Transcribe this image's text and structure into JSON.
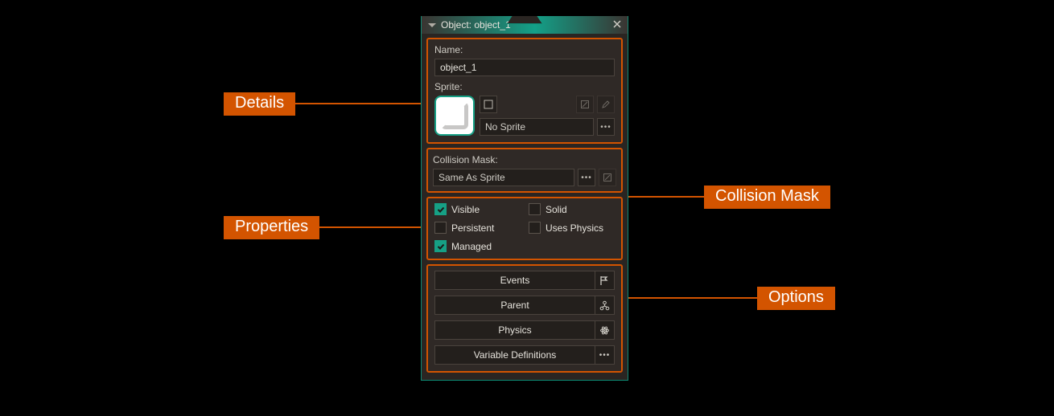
{
  "window": {
    "title": "Object: object_1"
  },
  "details": {
    "name_label": "Name:",
    "name_value": "object_1",
    "sprite_label": "Sprite:",
    "sprite_select": "No Sprite"
  },
  "collision": {
    "label": "Collision Mask:",
    "value": "Same As Sprite"
  },
  "props": {
    "visible": {
      "label": "Visible",
      "checked": true
    },
    "solid": {
      "label": "Solid",
      "checked": false
    },
    "persistent": {
      "label": "Persistent",
      "checked": false
    },
    "uses_physics": {
      "label": "Uses Physics",
      "checked": false
    },
    "managed": {
      "label": "Managed",
      "checked": true
    }
  },
  "options": {
    "events": "Events",
    "parent": "Parent",
    "physics": "Physics",
    "vardefs": "Variable Definitions"
  },
  "callouts": {
    "details": "Details",
    "properties": "Properties",
    "collision_mask": "Collision Mask",
    "options": "Options"
  },
  "icons": {
    "expand": "expand-icon",
    "edit": "edit-icon",
    "pencil": "pencil-icon",
    "more": "more-icon",
    "flag": "flag-icon",
    "parent": "parent-icon",
    "atom": "atom-icon",
    "close": "close-icon"
  },
  "colors": {
    "accent": "#16a085",
    "callout": "#d35400",
    "panel": "#2a2522",
    "field": "#231f1c"
  }
}
